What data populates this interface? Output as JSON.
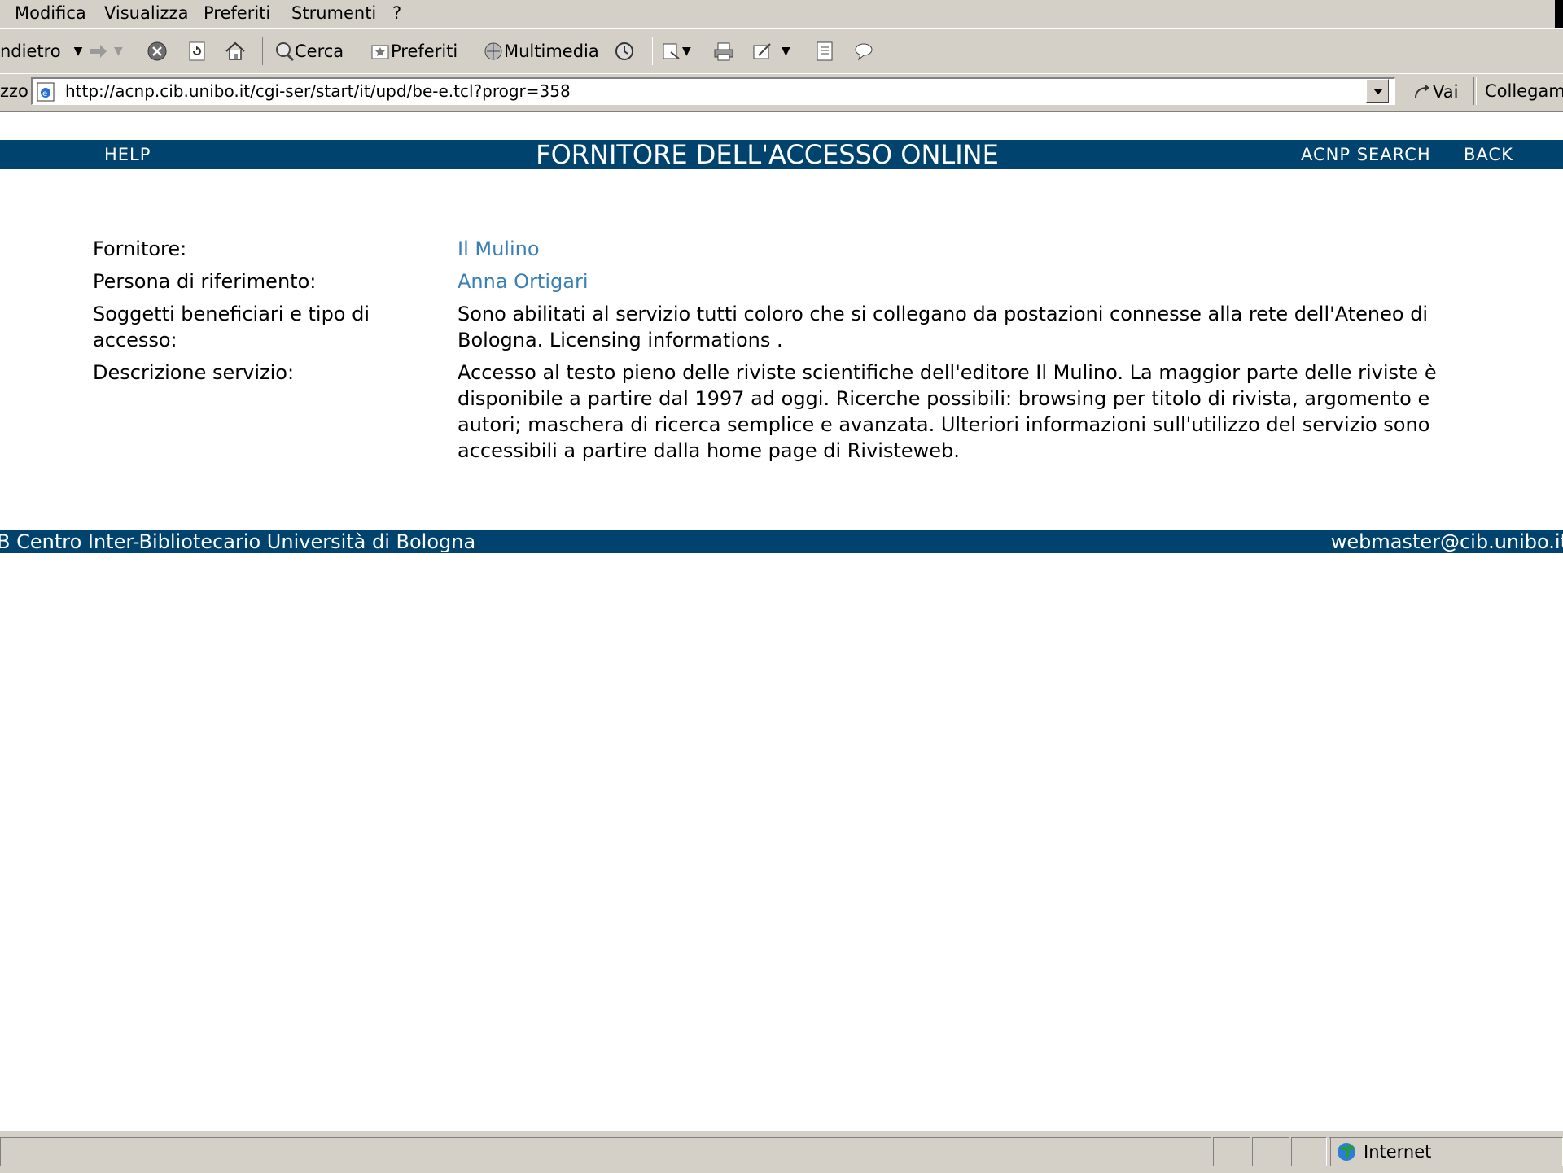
{
  "menu": {
    "items": [
      "Modifica",
      "Visualizza",
      "Preferiti",
      "Strumenti",
      "?"
    ]
  },
  "toolbar": {
    "back_label": "ndietro",
    "search_label": "Cerca",
    "favorites_label": "Preferiti",
    "media_label": "Multimedia"
  },
  "address": {
    "label": "zzo",
    "url": "http://acnp.cib.unibo.it/cgi-ser/start/it/upd/be-e.tcl?progr=358",
    "go_label": "Vai",
    "links_label": "Collegame"
  },
  "header": {
    "help": "HELP",
    "title": "FORNITORE DELL'ACCESSO ONLINE",
    "search": "ACNP SEARCH",
    "back": "BACK"
  },
  "details": {
    "provider_label": "Fornitore:",
    "provider_value": "Il Mulino",
    "contact_label": "Persona di riferimento:",
    "contact_value": "Anna Ortigari",
    "access_label": "Soggetti beneficiari e tipo di accesso:",
    "access_value": "Sono abilitati al servizio tutti coloro che si collegano da postazioni connesse alla rete dell'Ateneo di Bologna. Licensing informations .",
    "service_label": "Descrizione servizio:",
    "service_value": "Accesso al testo pieno delle riviste scientifiche dell'editore Il Mulino. La maggior parte delle riviste è disponibile a partire dal 1997 ad oggi. Ricerche possibili: browsing per titolo di rivista, argomento e autori; maschera di ricerca semplice e avanzata. Ulteriori informazioni sull'utilizzo del servizio sono accessibili a partire dalla home page di Rivisteweb."
  },
  "footer": {
    "left": "B Centro Inter-Bibliotecario Università di Bologna",
    "right": "webmaster@cib.unibo.it"
  },
  "status": {
    "zone": "Internet"
  },
  "colors": {
    "bar_blue": "#00436e",
    "link_blue": "#3a7fb7",
    "chrome_gray": "#d4d0c8"
  }
}
